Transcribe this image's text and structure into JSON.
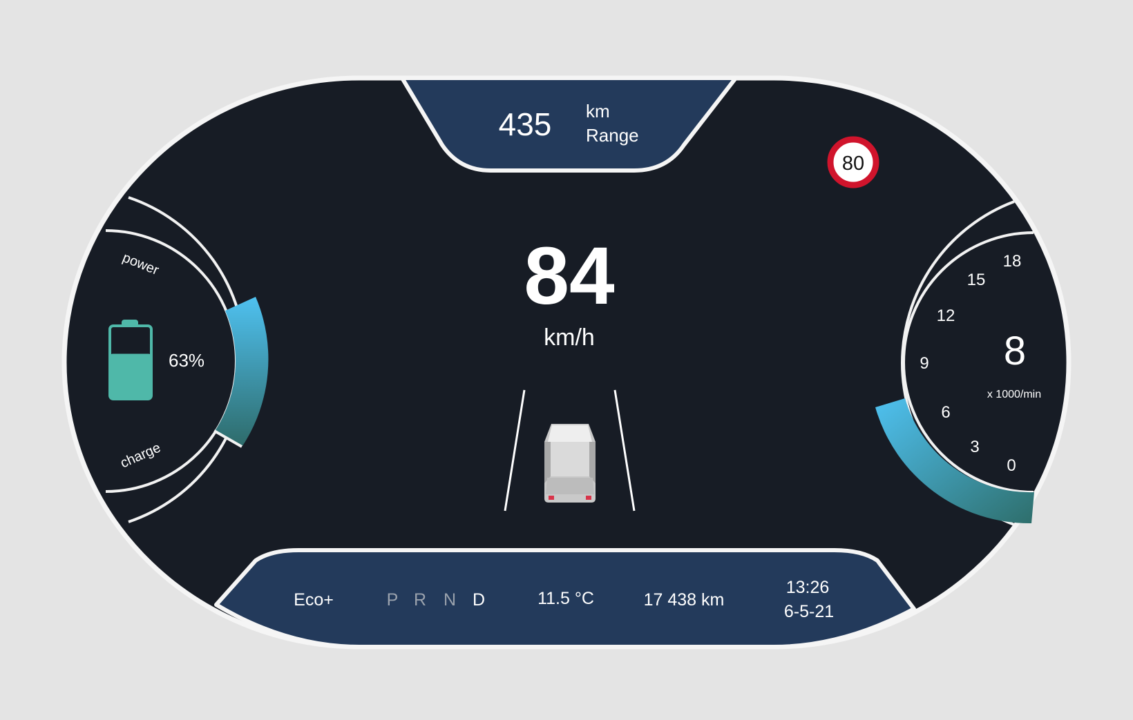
{
  "range": {
    "value": "435",
    "unit": "km",
    "label": "Range"
  },
  "speed": {
    "value": "84",
    "unit": "km/h"
  },
  "speed_limit": "80",
  "battery": {
    "percent_label": "63%",
    "level": 0.63,
    "power_label": "power",
    "charge_label": "charge"
  },
  "tachometer": {
    "value": "8",
    "unit": "x 1000/min",
    "ticks": [
      "0",
      "3",
      "6",
      "9",
      "12",
      "15",
      "18"
    ]
  },
  "status": {
    "drive_mode": "Eco+",
    "gears": [
      {
        "label": "P",
        "active": false
      },
      {
        "label": "R",
        "active": false
      },
      {
        "label": "N",
        "active": false
      },
      {
        "label": "D",
        "active": true
      }
    ],
    "temperature": "11.5 °C",
    "odometer": "17 438 km",
    "time": "13:26",
    "date": "6-5-21"
  },
  "colors": {
    "panel": "#171c25",
    "navy": "#233a5b",
    "accent_blue": "#4fc1f0",
    "accent_teal": "#2f6f6c",
    "battery": "#4fb8a9",
    "limit_red": "#d0142c"
  },
  "icons": {
    "battery": "battery-icon",
    "car": "car-icon",
    "speed_limit": "speed-limit-sign-icon"
  }
}
